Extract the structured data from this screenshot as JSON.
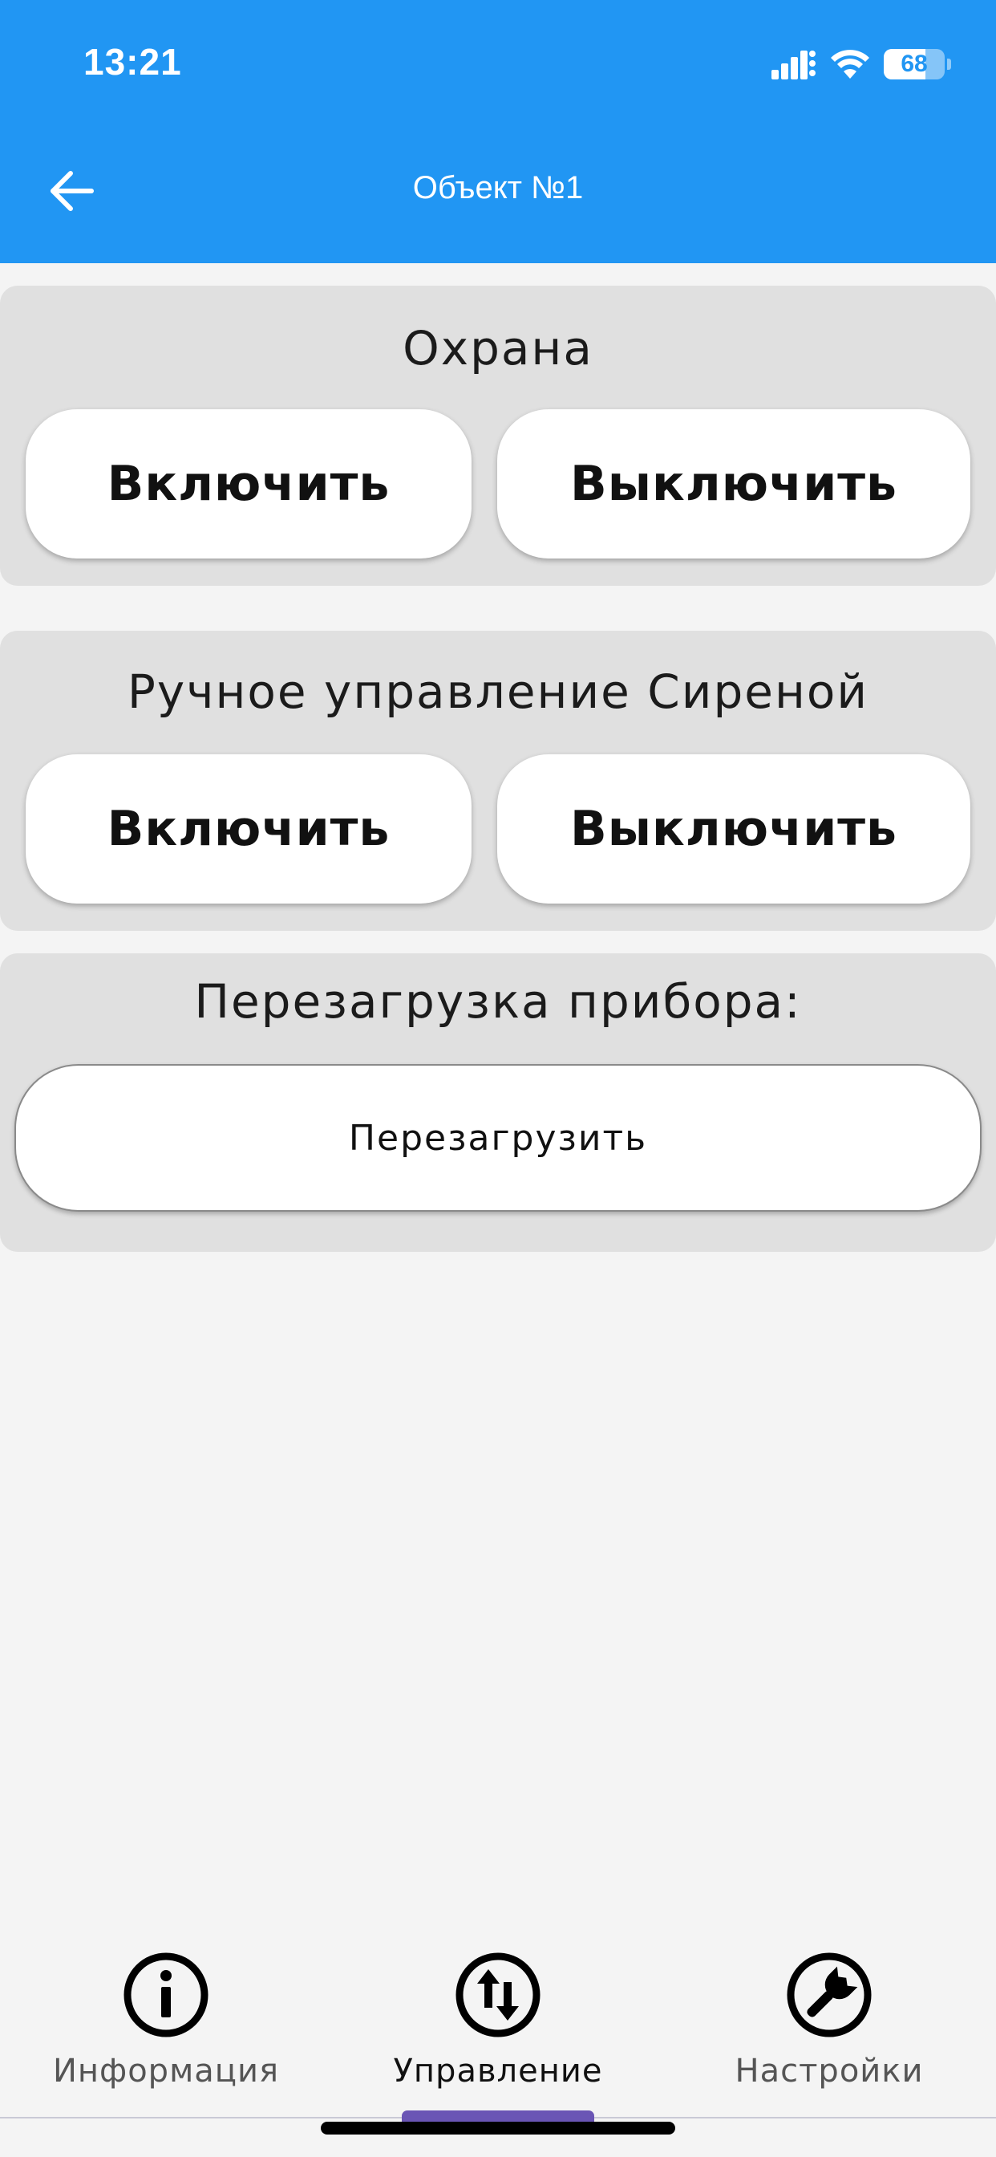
{
  "status_bar": {
    "time": "13:21",
    "battery_level": "68",
    "battery_fraction": 0.68
  },
  "header": {
    "title": "Объект №1",
    "background_color": "#2196f3"
  },
  "icons": {
    "back": "arrow-left-icon",
    "signal": "cellular-signal-icon",
    "wifi": "wifi-icon",
    "battery": "battery-icon",
    "info": "info-circle-icon",
    "control": "swap-vertical-circle-icon",
    "settings": "wrench-circle-icon"
  },
  "sections": {
    "security": {
      "title": "Охрана",
      "on_label": "Включить",
      "off_label": "Выключить"
    },
    "siren": {
      "title": "Ручное управление Сиреной",
      "on_label": "Включить",
      "off_label": "Выключить"
    },
    "reboot": {
      "title": "Перезагрузка прибора:",
      "button_label": "Перезагрузить"
    }
  },
  "bottom_nav": {
    "items": [
      {
        "label": "Информация",
        "active": false
      },
      {
        "label": "Управление",
        "active": true
      },
      {
        "label": "Настройки",
        "active": false
      }
    ],
    "indicator_color": "#6a55b5"
  }
}
